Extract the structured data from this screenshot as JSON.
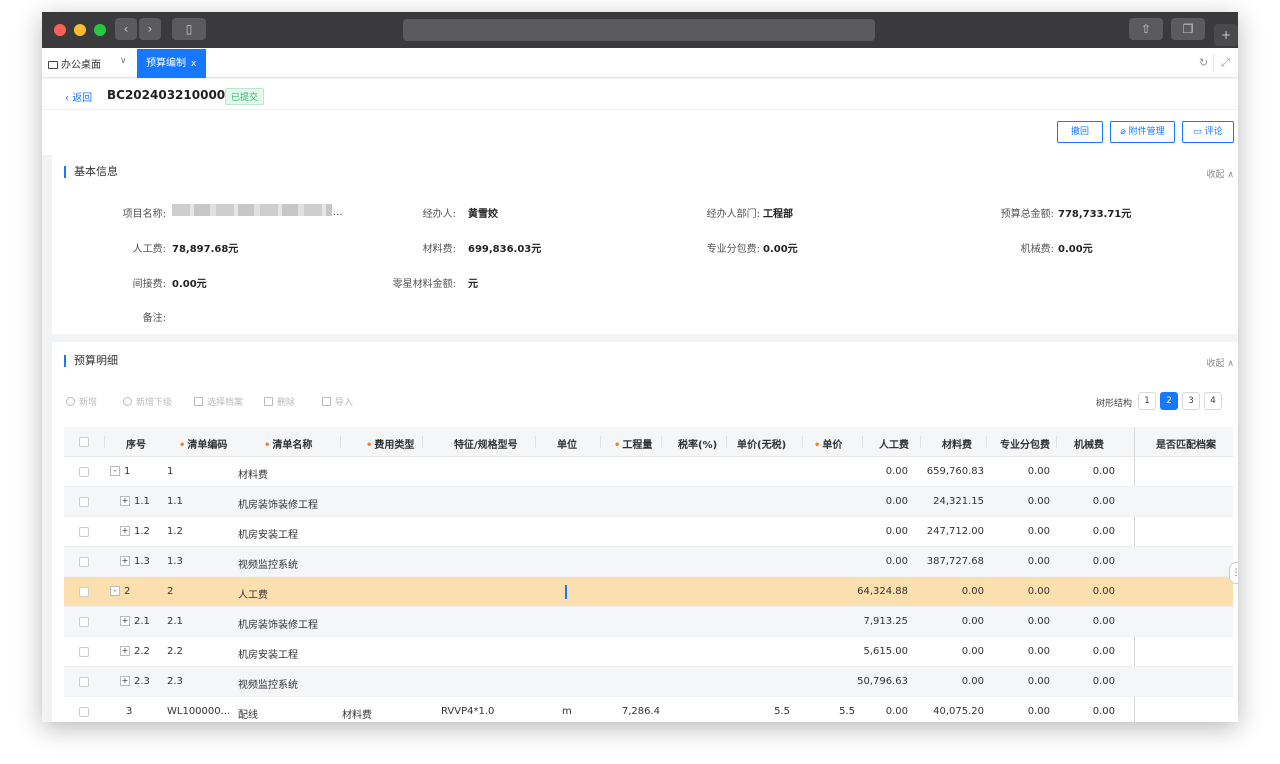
{
  "tabs": {
    "home_label": "办公桌面",
    "active_label": "预算编制",
    "close_glyph": "x"
  },
  "header": {
    "back_label": "返回",
    "doc_no": "BC20240321000009",
    "status": "已提交",
    "buttons": [
      "撤回",
      "附件管理",
      "评论"
    ]
  },
  "basic": {
    "title": "基本信息",
    "collapse_label": "收起",
    "fields": [
      {
        "label": "项目名称:",
        "value": "..."
      },
      {
        "label": "经办人:",
        "value": "黄雪姣"
      },
      {
        "label": "经办人部门:",
        "value": "工程部"
      },
      {
        "label": "预算总金额:",
        "value": "778,733.71元"
      },
      {
        "label": "人工费:",
        "value": "78,897.68元"
      },
      {
        "label": "材料费:",
        "value": "699,836.03元"
      },
      {
        "label": "专业分包费:",
        "value": "0.00元"
      },
      {
        "label": "机械费:",
        "value": "0.00元"
      },
      {
        "label": "间接费:",
        "value": "0.00元"
      },
      {
        "label": "零星材料金额:",
        "value": "元"
      },
      {
        "label": "备注:",
        "value": ""
      }
    ]
  },
  "detail": {
    "title": "预算明细",
    "collapse_label": "收起",
    "toolbar": [
      "新增",
      "新增下级",
      "选择档案",
      "删除",
      "导入"
    ],
    "tree_label": "树形结构",
    "pages": [
      "1",
      "2",
      "3",
      "4"
    ],
    "active_page": 2,
    "columns": [
      "序号",
      "清单编码",
      "清单名称",
      "费用类型",
      "特征/规格型号",
      "单位",
      "工程量",
      "税率(%)",
      "单价(无税)",
      "单价",
      "人工费",
      "材料费",
      "专业分包费",
      "机械费",
      "是否匹配档案"
    ],
    "rows": [
      {
        "exp": "-",
        "seq": "1",
        "code": "1",
        "name": "材料费",
        "fee": "",
        "spec": "",
        "unit": "",
        "qty": "",
        "tax": "",
        "pnt": "",
        "price": "",
        "labor": "0.00",
        "mat": "659,760.83",
        "sub": "0.00",
        "mech": "0.00"
      },
      {
        "exp": "+",
        "seq": "1.1",
        "code": "1.1",
        "name": "机房装饰装修工程",
        "fee": "",
        "spec": "",
        "unit": "",
        "qty": "",
        "tax": "",
        "pnt": "",
        "price": "",
        "labor": "0.00",
        "mat": "24,321.15",
        "sub": "0.00",
        "mech": "0.00"
      },
      {
        "exp": "+",
        "seq": "1.2",
        "code": "1.2",
        "name": "机房安装工程",
        "fee": "",
        "spec": "",
        "unit": "",
        "qty": "",
        "tax": "",
        "pnt": "",
        "price": "",
        "labor": "0.00",
        "mat": "247,712.00",
        "sub": "0.00",
        "mech": "0.00"
      },
      {
        "exp": "+",
        "seq": "1.3",
        "code": "1.3",
        "name": "视频监控系统",
        "fee": "",
        "spec": "",
        "unit": "",
        "qty": "",
        "tax": "",
        "pnt": "",
        "price": "",
        "labor": "0.00",
        "mat": "387,727.68",
        "sub": "0.00",
        "mech": "0.00"
      },
      {
        "exp": "-",
        "seq": "2",
        "code": "2",
        "name": "人工费",
        "fee": "",
        "spec": "",
        "unit": "",
        "qty": "",
        "tax": "",
        "pnt": "",
        "price": "",
        "labor": "64,324.88",
        "mat": "0.00",
        "sub": "0.00",
        "mech": "0.00"
      },
      {
        "exp": "+",
        "seq": "2.1",
        "code": "2.1",
        "name": "机房装饰装修工程",
        "fee": "",
        "spec": "",
        "unit": "",
        "qty": "",
        "tax": "",
        "pnt": "",
        "price": "",
        "labor": "7,913.25",
        "mat": "0.00",
        "sub": "0.00",
        "mech": "0.00"
      },
      {
        "exp": "+",
        "seq": "2.2",
        "code": "2.2",
        "name": "机房安装工程",
        "fee": "",
        "spec": "",
        "unit": "",
        "qty": "",
        "tax": "",
        "pnt": "",
        "price": "",
        "labor": "5,615.00",
        "mat": "0.00",
        "sub": "0.00",
        "mech": "0.00"
      },
      {
        "exp": "+",
        "seq": "2.3",
        "code": "2.3",
        "name": "视频监控系统",
        "fee": "",
        "spec": "",
        "unit": "",
        "qty": "",
        "tax": "",
        "pnt": "",
        "price": "",
        "labor": "50,796.63",
        "mat": "0.00",
        "sub": "0.00",
        "mech": "0.00"
      },
      {
        "exp": "",
        "seq": "3",
        "code": "WL100000...",
        "name": "配线",
        "fee": "材料费",
        "spec": "RVVP4*1.0",
        "unit": "m",
        "qty": "7,286.4",
        "tax": "",
        "pnt": "5.5",
        "price": "5.5",
        "labor": "0.00",
        "mat": "40,075.20",
        "sub": "0.00",
        "mech": "0.00"
      }
    ]
  },
  "colors": {
    "accent": "#1677ff",
    "selected_row": "#fbdfae",
    "status_green": "#2fb56a",
    "required": "#ff7a1a"
  }
}
